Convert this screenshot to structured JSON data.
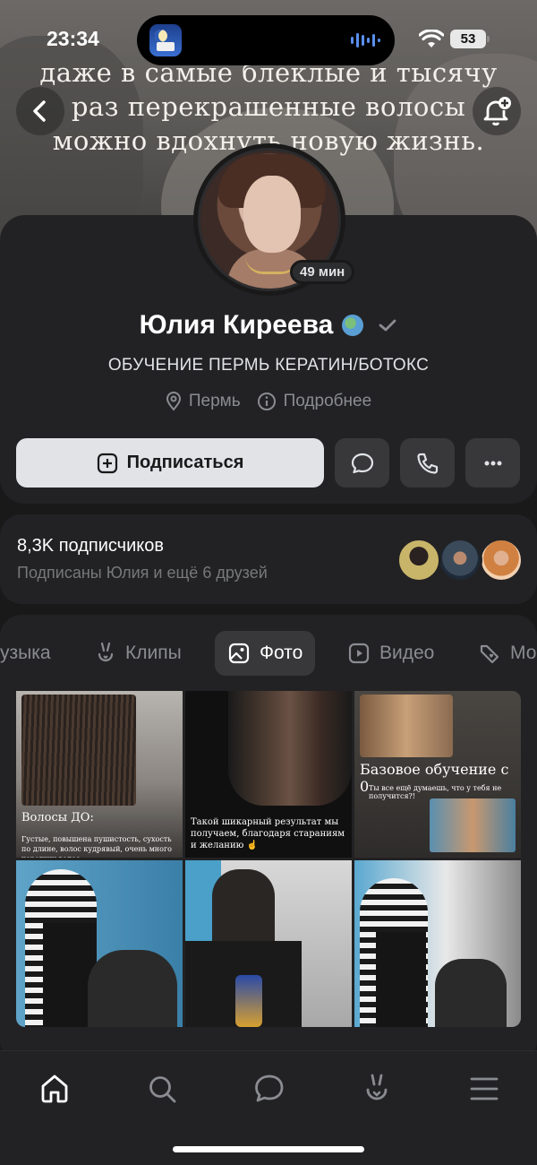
{
  "status_bar": {
    "time": "23:34",
    "battery": "53"
  },
  "cover": {
    "text_lines": [
      "даже в самые блеклые и тысячу",
      "раз перекрашенные волосы",
      "можно вдохнуть новую жизнь."
    ]
  },
  "profile": {
    "online_badge": "49 мин",
    "name": "Юлия Киреева",
    "status": "ОБУЧЕНИЕ ПЕРМЬ КЕРАТИН/БОТОКС",
    "city": "Пермь",
    "more": "Подробнее"
  },
  "actions": {
    "subscribe_label": "Подписаться"
  },
  "followers": {
    "count": "8,3K подписчиков",
    "friends": "Подписаны Юлия и ещё 6 друзей"
  },
  "tabs": [
    {
      "label": "узыка",
      "icon": "music-icon"
    },
    {
      "label": "Клипы",
      "icon": "clips-icon"
    },
    {
      "label": "Фото",
      "icon": "photo-icon"
    },
    {
      "label": "Видео",
      "icon": "video-icon"
    },
    {
      "label": "Мо",
      "icon": "market-icon"
    }
  ],
  "active_tab": "Фото",
  "photos": [
    {
      "caption": "Волосы ДО:",
      "subcaption": "Густые, повышена пушистость, сухость по длине, волос кудрявый, очень много коротких волос..."
    },
    {
      "caption": "Такой шикарный результат мы получаем, благодаря стараниям и желанию ☝"
    },
    {
      "caption": "Базовое обучение с 0",
      "subcaption": "Ты все ещё думаешь, что у тебя не получится?!"
    },
    {
      "caption": ""
    },
    {
      "caption": ""
    },
    {
      "caption": ""
    }
  ],
  "colors": {
    "background": "#19191a",
    "card": "#222224",
    "button": "#38383a",
    "primary_button": "#e1e3e6"
  },
  "bottom_nav": [
    "home-icon",
    "search-icon",
    "messages-icon",
    "clips-icon",
    "menu-icon"
  ]
}
